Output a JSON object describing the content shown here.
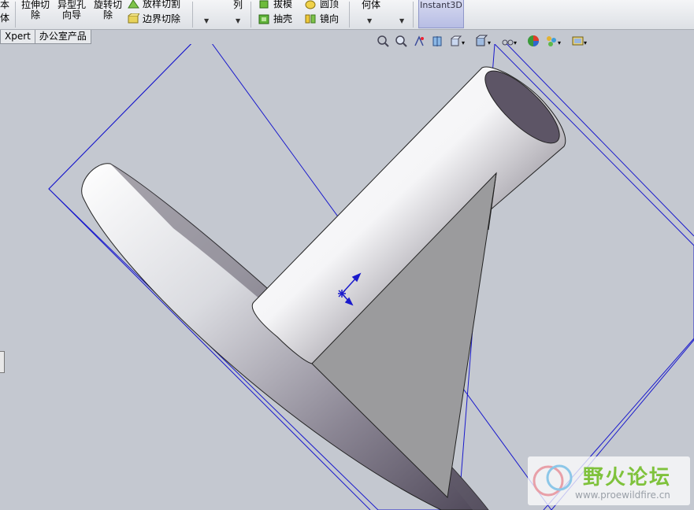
{
  "toolbar": {
    "partial_left_top": "本",
    "partial_left_bottom": "体",
    "extrude_cut": {
      "line1": "拉伸切",
      "line2": "除"
    },
    "hole_wizard": {
      "line1": "异型孔",
      "line2": "向导"
    },
    "revolve_cut": {
      "line1": "旋转切",
      "line2": "除"
    },
    "loft_cut": "放样切割",
    "boundary_cut": "边界切除",
    "pattern": "列",
    "draft": "拔模",
    "shell": "抽壳",
    "dome": "圆顶",
    "mirror": "镜向",
    "ref_geometry": "何体",
    "instant3d": "Instant3D"
  },
  "tabs": [
    {
      "label": "Xpert"
    },
    {
      "label": "办公室产品"
    }
  ],
  "watermark": {
    "title": "野火论坛",
    "url": "www.proewildfire.cn"
  },
  "colors": {
    "viewport_bg": "#c4c8d0",
    "plane_line": "#1a1acc",
    "triad": "#1a1acc",
    "watermark_green": "#7fc23c"
  }
}
